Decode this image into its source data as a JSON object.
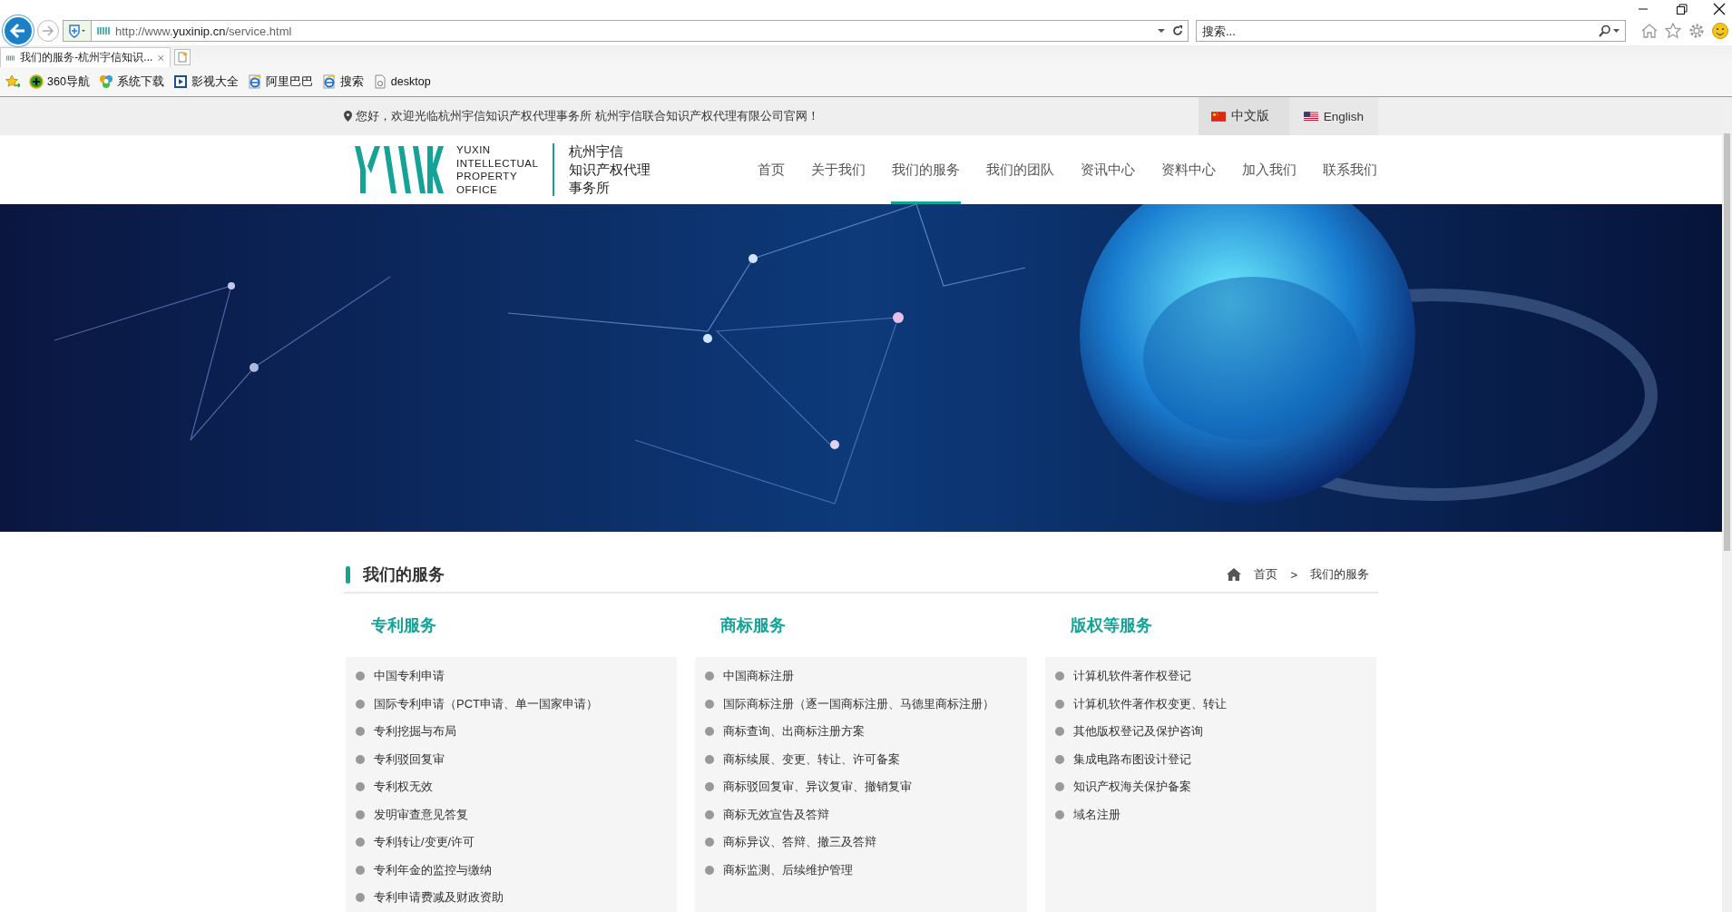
{
  "browser": {
    "address": {
      "prefix": "http://www.",
      "domain": "yuxinip.cn",
      "path": "/service.html"
    },
    "search": {
      "placeholder": "搜索..."
    },
    "tabs": [
      {
        "title": "我们的服务-杭州宇信知识...",
        "selected": true
      }
    ],
    "favorites": [
      {
        "label": "360导航",
        "kind": "navigation"
      },
      {
        "label": "系统下载",
        "kind": "download"
      },
      {
        "label": "影视大全",
        "kind": "video"
      },
      {
        "label": "阿里巴巴",
        "kind": "web"
      },
      {
        "label": "搜索",
        "kind": "web"
      },
      {
        "label": "desktop",
        "kind": "file"
      }
    ]
  },
  "topbar": {
    "welcome": "您好，欢迎光临杭州宇信知识产权代理事务所 杭州宇信联合知识产权代理有限公司官网！",
    "languages": [
      {
        "label": "中文版",
        "kind": "cn",
        "selected": true
      },
      {
        "label": "English",
        "kind": "us",
        "selected": false
      }
    ]
  },
  "logo": {
    "english_lines": [
      "YUXIN",
      "INTELLECTUAL",
      "PROPERTY",
      "OFFICE"
    ],
    "chinese_lines": [
      "杭州宇信",
      "知识产权代理",
      "事务所"
    ]
  },
  "nav": [
    {
      "label": "首页",
      "selected": false
    },
    {
      "label": "关于我们",
      "selected": false
    },
    {
      "label": "我们的服务",
      "selected": true
    },
    {
      "label": "我们的团队",
      "selected": false
    },
    {
      "label": "资讯中心",
      "selected": false
    },
    {
      "label": "资料中心",
      "selected": false
    },
    {
      "label": "加入我们",
      "selected": false
    },
    {
      "label": "联系我们",
      "selected": false
    }
  ],
  "section": {
    "title": "我们的服务",
    "breadcrumb": [
      "首页",
      ">",
      "我们的服务"
    ]
  },
  "columns": [
    {
      "heading": "专利服务",
      "items": [
        "中国专利申请",
        "国际专利申请（PCT申请、单一国家申请）",
        "专利挖掘与布局",
        "专利驳回复审",
        "专利权无效",
        "发明审查意见答复",
        "专利转让/变更/许可",
        "专利年金的监控与缴纳",
        "专利申请费减及财政资助"
      ]
    },
    {
      "heading": "商标服务",
      "items": [
        "中国商标注册",
        "国际商标注册（逐一国商标注册、马德里商标注册）",
        "商标查询、出商标注册方案",
        "商标续展、变更、转让、许可备案",
        "商标驳回复审、异议复审、撤销复审",
        "商标无效宣告及答辩",
        "商标异议、答辩、撤三及答辩",
        "商标监测、后续维护管理"
      ]
    },
    {
      "heading": "版权等服务",
      "items": [
        "计算机软件著作权登记",
        "计算机软件著作权变更、转让",
        "其他版权登记及保护咨询",
        "集成电路布图设计登记",
        "知识产权海关保护备案",
        "域名注册"
      ]
    }
  ]
}
